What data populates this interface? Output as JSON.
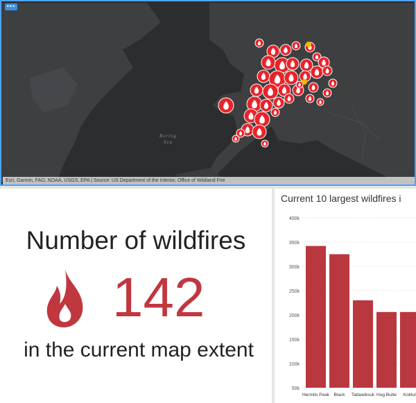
{
  "map": {
    "menu_icon": "ellipsis-icon",
    "sea_label_line1": "Bering",
    "sea_label_line2": "Sea",
    "attribution": "Esri, Garmin, FAO, NOAA, USGS, EPA | Source: US Department of the Interior, Office of Wildland Fire",
    "colors": {
      "background": "#2b2d2e",
      "land": "#3d3f40",
      "fire": "#e8242b",
      "fire_selected": "#f5b800"
    }
  },
  "indicator": {
    "title": "Number of wildfires",
    "value": "142",
    "subtitle": "in the current map extent",
    "icon": "flame-icon",
    "color": "#c0373f"
  },
  "chart_data": {
    "type": "bar",
    "title": "Current 10 largest wildfires i",
    "categories": [
      "Hermits Peak",
      "Black",
      "Tatlawiksuk",
      "Hog Butte",
      "Koktuli"
    ],
    "values": [
      342000,
      325000,
      230000,
      206000,
      206000
    ],
    "yticks": [
      "400k",
      "350k",
      "300k",
      "250k",
      "200k",
      "150k",
      "100k",
      "50k"
    ],
    "ylim": [
      50000,
      400000
    ],
    "bar_color": "#b93840"
  }
}
